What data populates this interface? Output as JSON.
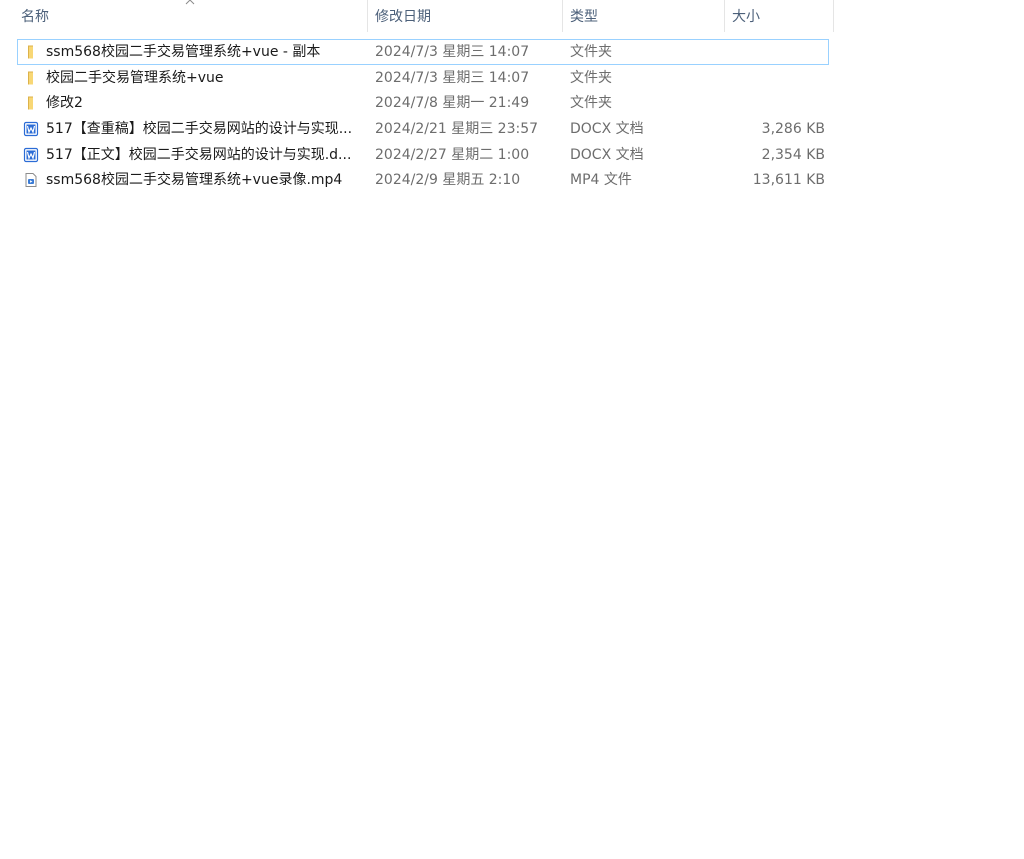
{
  "columns": {
    "name": "名称",
    "date": "修改日期",
    "type": "类型",
    "size": "大小"
  },
  "sort": {
    "column": "name",
    "direction": "ascending",
    "icon": "sort-up-caret-icon"
  },
  "files": [
    {
      "icon": "folder-icon",
      "name": "ssm568校园二手交易管理系统+vue - 副本",
      "date": "2024/7/3 星期三 14:07",
      "type": "文件夹",
      "size": "",
      "focused": true
    },
    {
      "icon": "folder-icon",
      "name": "校园二手交易管理系统+vue",
      "date": "2024/7/3 星期三 14:07",
      "type": "文件夹",
      "size": ""
    },
    {
      "icon": "folder-icon",
      "name": "修改2",
      "date": "2024/7/8 星期一 21:49",
      "type": "文件夹",
      "size": ""
    },
    {
      "icon": "word-document-icon",
      "name": "517【查重稿】校园二手交易网站的设计与实现...",
      "date": "2024/2/21 星期三 23:57",
      "type": "DOCX 文档",
      "size": "3,286 KB"
    },
    {
      "icon": "word-document-icon",
      "name": "517【正文】校园二手交易网站的设计与实现.d...",
      "date": "2024/2/27 星期二 1:00",
      "type": "DOCX 文档",
      "size": "2,354 KB"
    },
    {
      "icon": "video-file-icon",
      "name": "ssm568校园二手交易管理系统+vue录像.mp4",
      "date": "2024/2/9 星期五 2:10",
      "type": "MP4 文件",
      "size": "13,611 KB"
    }
  ],
  "colors": {
    "header_text": "#4c607a",
    "focus_border": "#99d1ff",
    "folder": "#f8d775",
    "word_blue": "#2b6cd6"
  }
}
